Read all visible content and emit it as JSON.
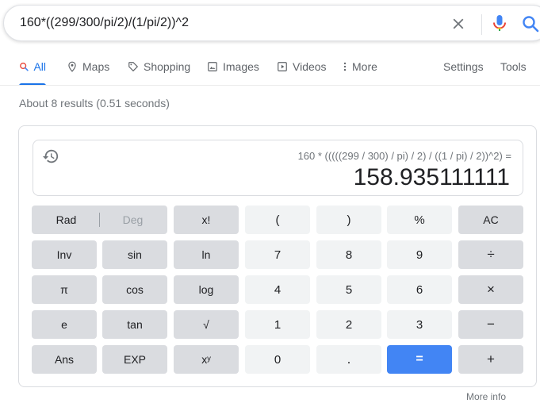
{
  "search": {
    "query": "160*((299/300/pi/2)/(1/pi/2))^2",
    "clear_icon": "close-icon",
    "mic_icon": "mic-icon",
    "search_icon": "search-icon"
  },
  "tabs": [
    {
      "label": "All",
      "icon": "search-icon",
      "active": true
    },
    {
      "label": "Maps",
      "icon": "map-pin-icon"
    },
    {
      "label": "Shopping",
      "icon": "tag-icon"
    },
    {
      "label": "Images",
      "icon": "image-icon"
    },
    {
      "label": "Videos",
      "icon": "play-icon"
    },
    {
      "label": "More",
      "icon": "more-vert-icon"
    }
  ],
  "tools": {
    "settings": "Settings",
    "tools": "Tools"
  },
  "result_stats": "About 8 results (0.51 seconds)",
  "calculator": {
    "expression": "160 * (((((299 / 300) / pi) / 2) / ((1 / pi) / 2))^2) =",
    "result": "158.935111111",
    "keys": {
      "rad": "Rad",
      "deg": "Deg",
      "fact": "x!",
      "lparen": "(",
      "rparen": ")",
      "percent": "%",
      "ac": "AC",
      "inv": "Inv",
      "sin": "sin",
      "ln": "ln",
      "n7": "7",
      "n8": "8",
      "n9": "9",
      "divide": "÷",
      "pi": "π",
      "cos": "cos",
      "log": "log",
      "n4": "4",
      "n5": "5",
      "n6": "6",
      "multiply": "×",
      "e": "e",
      "tan": "tan",
      "sqrt": "√",
      "n1": "1",
      "n2": "2",
      "n3": "3",
      "minus": "−",
      "ans": "Ans",
      "exp": "EXP",
      "pow": "xʸ",
      "n0": "0",
      "dot": ".",
      "equals": "=",
      "plus": "+"
    }
  },
  "more_info": "More info",
  "colors": {
    "accent": "#1a73e8",
    "equals_key": "#4285f4",
    "op_key": "#dadce0",
    "num_key": "#f1f3f4"
  }
}
